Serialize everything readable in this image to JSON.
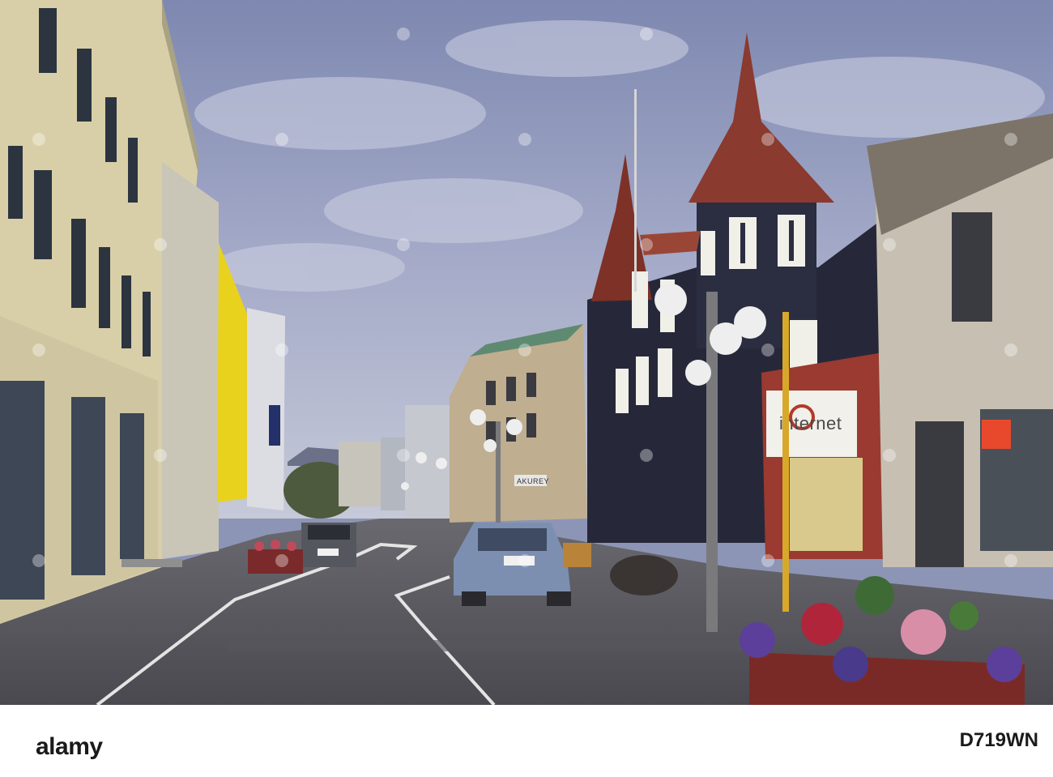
{
  "photo": {
    "subject": "",
    "signs": {
      "cafe_sign": "internet",
      "shop_sign": "AKUREY"
    }
  },
  "watermark": {
    "text": "alamy"
  },
  "footer": {
    "brand": "alamy",
    "image_id": "D719WN"
  },
  "colors": {
    "sky": "#9aa3c4",
    "pavement": "#5d5c62",
    "dark_building": "#26283a",
    "roof_red": "#8a3a2e",
    "yellow_facade": "#e9d21d"
  }
}
